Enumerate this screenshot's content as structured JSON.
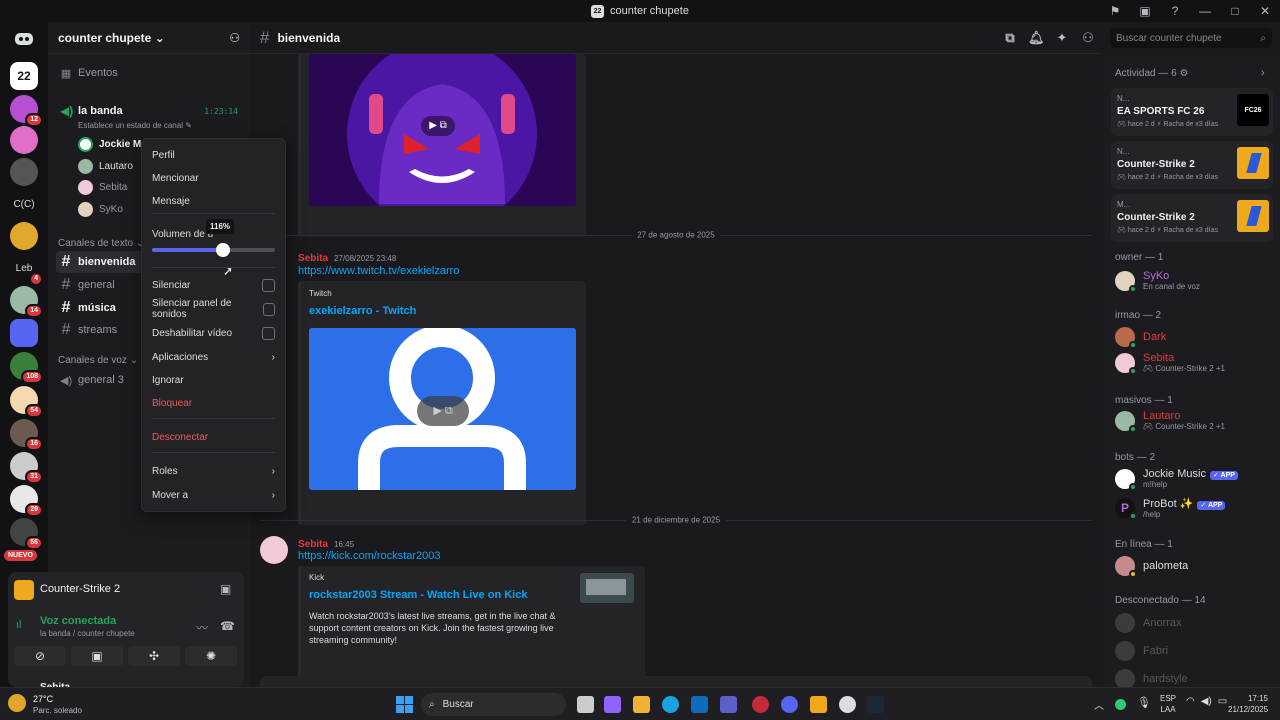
{
  "window": {
    "title": "counter chupete",
    "server_short": "22"
  },
  "guilds": [
    {
      "badge": ""
    },
    {
      "badge": "12"
    },
    {
      "badge": ""
    },
    {
      "badge": ""
    },
    {
      "label": "C(C)"
    },
    {
      "badge": ""
    },
    {
      "label": "Leb",
      "badge": "4"
    },
    {
      "badge": "14"
    },
    {
      "badge": ""
    },
    {
      "badge": "108"
    },
    {
      "badge": "54"
    },
    {
      "badge": "16"
    },
    {
      "badge": "31"
    },
    {
      "badge": "29"
    },
    {
      "badge": "56"
    },
    {
      "label": "NUEVO"
    }
  ],
  "sidebar": {
    "server_name": "counter chupete",
    "events": "Eventos",
    "voice_channel": "la banda",
    "voice_timer": "1:23:14",
    "voice_status": "Establece un estado de canal",
    "voice_users": [
      "Jockie Mu",
      "Lautaro",
      "Sebita",
      "SyKo"
    ],
    "text_category": "Canales de texto",
    "text_channels": [
      "bienvenida",
      "general",
      "música",
      "streams"
    ],
    "voice_category": "Canales de voz",
    "voice_channels": [
      "general 3"
    ]
  },
  "context_menu": {
    "items_top": [
      "Perfil",
      "Mencionar",
      "Mensaje"
    ],
    "volume_label": "Volumen de u",
    "volume_tooltip": "116%",
    "volume_fraction": 0.58,
    "toggles": [
      "Silenciar",
      "Silenciar panel de sonidos",
      "Deshabilitar vídeo"
    ],
    "apps": "Aplicaciones",
    "ignore": "Ignorar",
    "block": "Bloquear",
    "disconnect": "Desconectar",
    "roles": "Roles",
    "move": "Mover a"
  },
  "channel": {
    "name": "bienvenida",
    "search_placeholder": "Buscar counter chupete"
  },
  "messages": {
    "date1": "27 de agosto de 2025",
    "author1": "Sebita",
    "time1": "27/08/2025 23:48",
    "link1": "https://www.twitch.tv/exekielzarro",
    "embed1_provider": "Twitch",
    "embed1_title": "exekielzarro - Twitch",
    "date2": "21 de diciembre de 2025",
    "author2": "Sebita",
    "time2": "16:45",
    "link2": "https://kick.com/rockstar2003",
    "embed2_provider": "Kick",
    "embed2_title": "rockstar2003 Stream - Watch Live on Kick",
    "embed2_desc": "Watch rockstar2003's latest live streams, get in the live chat & support content creators on Kick. Join the fastest growing live streaming community!"
  },
  "members": {
    "activity_header": "Actividad — 6",
    "activities": [
      {
        "user": "N...",
        "game": "EA SPORTS FC 26",
        "meta": "hace 2 d",
        "streak": "Racha de x3 días"
      },
      {
        "user": "N...",
        "game": "Counter-Strike 2",
        "meta": "hace 2 d",
        "streak": "Racha de x3 días"
      },
      {
        "user": "M...",
        "game": "Counter-Strike 2",
        "meta": "hace 2 d",
        "streak": "Racha de x3 días"
      }
    ],
    "owner_header": "owner — 1",
    "owner": {
      "name": "SyKo",
      "sub": "En canal de voz"
    },
    "irmao_header": "irmao — 2",
    "irmao": [
      {
        "name": "Dark",
        "sub": ""
      },
      {
        "name": "Sebita",
        "sub": "Counter-Strike 2 +1"
      }
    ],
    "masivos_header": "masivos — 1",
    "masivos": [
      {
        "name": "Lautaro",
        "sub": "Counter-Strike 2 +1"
      }
    ],
    "bots_header": "bots — 2",
    "bots": [
      {
        "name": "Jockie Music",
        "sub": "m!help",
        "badge": "✓ APP"
      },
      {
        "name": "ProBot ✨",
        "sub": "/help",
        "badge": "✓ APP"
      }
    ],
    "online_header": "En línea — 1",
    "online": [
      {
        "name": "palometa"
      }
    ],
    "offline_header": "Desconectado — 14",
    "offline": [
      "Anorrax",
      "Fabri",
      "hardstyle"
    ]
  },
  "user_panel": {
    "activity": "Counter-Strike 2",
    "voice_status": "Voz conectada",
    "voice_location": "la banda / counter chupete",
    "username": "Sebita"
  },
  "taskbar": {
    "weather_temp": "27°C",
    "weather_desc": "Parc. soleado",
    "search": "Buscar",
    "lang1": "ESP",
    "lang2": "LAA",
    "time": "17:15",
    "date": "21/12/2025"
  },
  "colors": {
    "accent": "#5865f2",
    "online": "#23a55a",
    "danger": "#da373c",
    "link": "#00a8fc"
  }
}
